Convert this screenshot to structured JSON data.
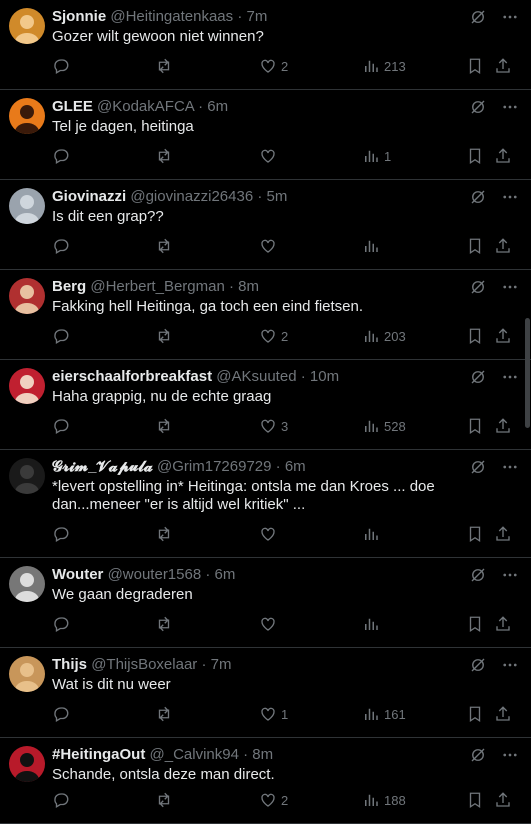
{
  "tweets": [
    {
      "name": "Sjonnie",
      "handle": "@Heitingatenkaas",
      "time": "7m",
      "text": "Gozer wilt gewoon niet winnen?",
      "likes": "2",
      "views": "213"
    },
    {
      "name": "GLEE",
      "handle": "@KodakAFCA",
      "time": "6m",
      "text": "Tel je dagen, heitinga",
      "likes": "",
      "views": "1"
    },
    {
      "name": "Giovinazzi",
      "handle": "@giovinazzi26436",
      "time": "5m",
      "text": "Is dit een grap??",
      "likes": "",
      "views": ""
    },
    {
      "name": "Berg",
      "handle": "@Herbert_Bergman",
      "time": "8m",
      "text": "Fakking hell Heitinga, ga toch een eind fietsen.",
      "likes": "2",
      "views": "203"
    },
    {
      "name": "eierschaalforbreakfast",
      "handle": "@AKsuuted",
      "time": "10m",
      "text": "Haha grappig, nu de echte graag",
      "likes": "3",
      "views": "528"
    },
    {
      "name": "𝓖𝓻𝓲𝓶_𝓥𝓪𝓹𝓾𝓵𝓪",
      "handle": "@Grim17269729",
      "time": "6m",
      "text": "*levert opstelling in* Heitinga: ontsla me dan Kroes ... doe dan...meneer \"er is altijd wel kritiek\"  ...",
      "likes": "",
      "views": ""
    },
    {
      "name": "Wouter",
      "handle": "@wouter1568",
      "time": "6m",
      "text": "We gaan degraderen",
      "likes": "",
      "views": ""
    },
    {
      "name": "Thijs",
      "handle": "@ThijsBoxelaar",
      "time": "7m",
      "text": "Wat is dit nu weer",
      "likes": "1",
      "views": "161"
    },
    {
      "name": "#HeitingaOut",
      "handle": "@_Calvink94",
      "time": "8m",
      "text": "Schande, ontsla deze man direct.",
      "likes": "2",
      "views": "188"
    }
  ],
  "separator": "·",
  "icons": {
    "reply": "reply-icon",
    "retweet": "retweet-icon",
    "like": "heart-icon",
    "views": "views-icon",
    "bookmark": "bookmark-icon",
    "share": "share-icon",
    "grok": "grok-icon",
    "more": "more-icon"
  },
  "colors": {
    "background": "#000000",
    "text": "#e7e9ea",
    "muted": "#71767b",
    "border": "#2f3336"
  }
}
